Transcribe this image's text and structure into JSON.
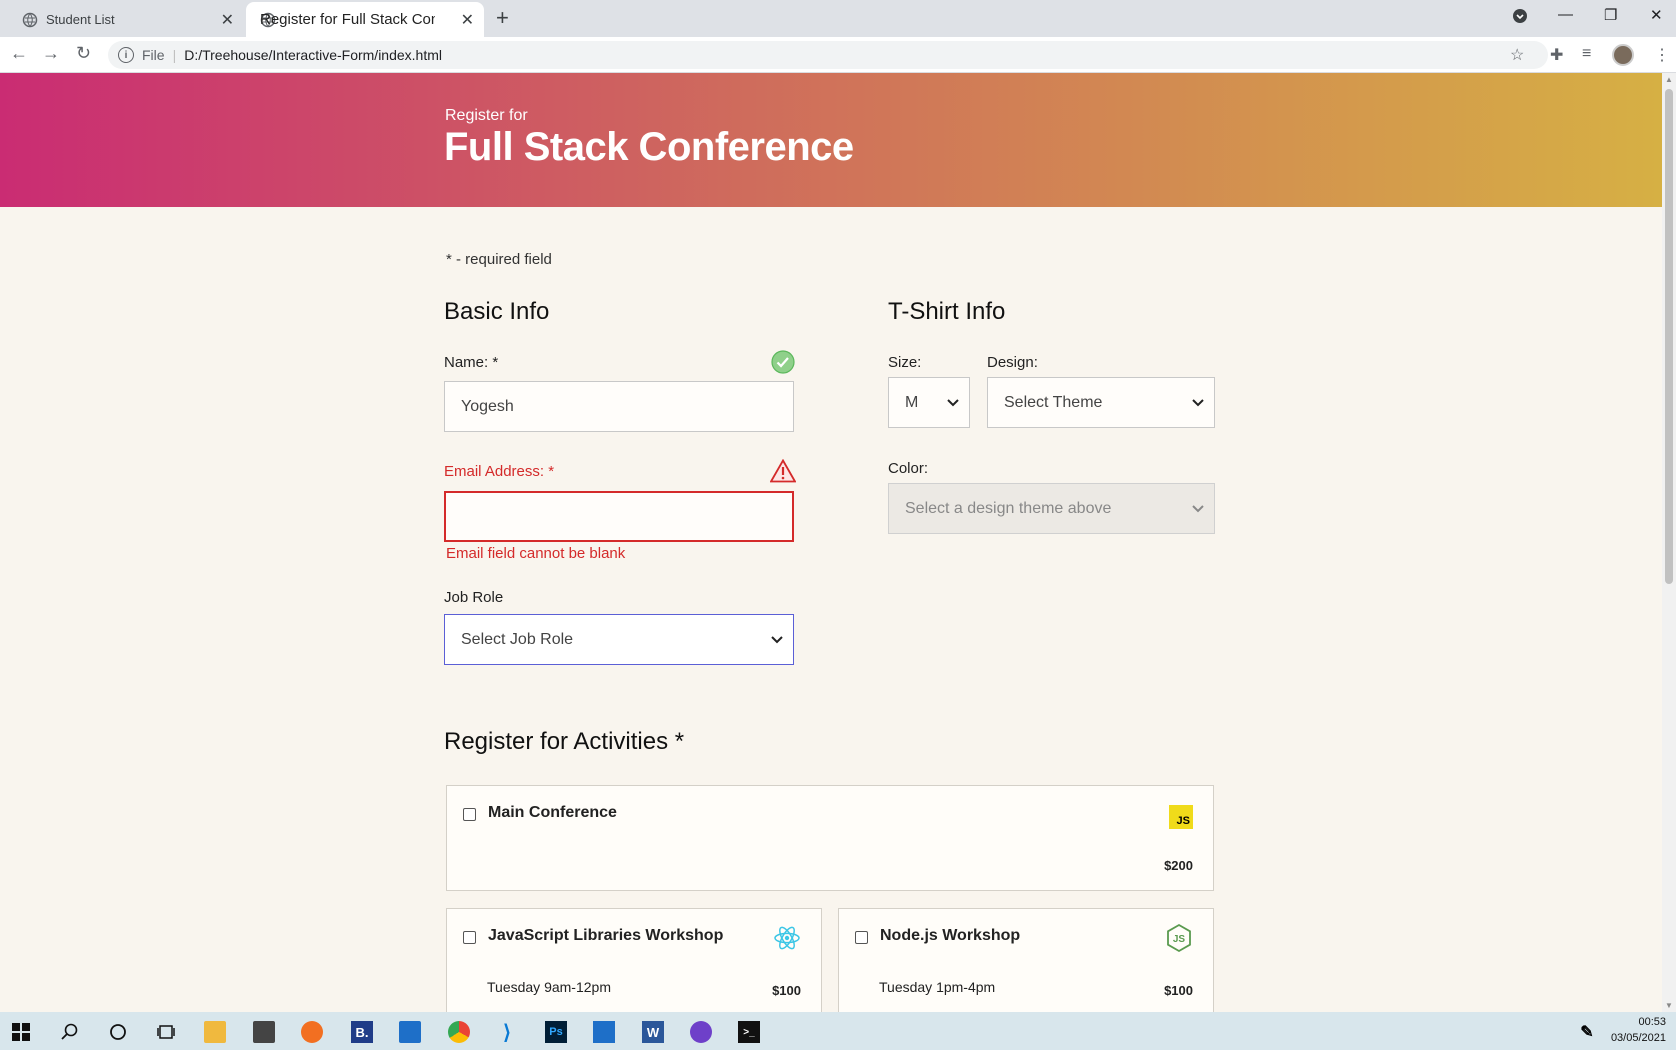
{
  "browser": {
    "tabs": [
      {
        "label": "Student List"
      },
      {
        "label": "Register for Full Stack Conference"
      }
    ],
    "url_scheme": "File",
    "url": "D:/Treehouse/Interactive-Form/index.html"
  },
  "header": {
    "pre_title": "Register for",
    "title": "Full Stack Conference"
  },
  "form": {
    "required_note": "- required field",
    "required_mark": "*",
    "basic_info": {
      "heading": "Basic Info",
      "name_label": "Name:",
      "name_value": "Yogesh",
      "email_label": "Email Address:",
      "email_value": "",
      "email_error": "Email field cannot be blank",
      "job_role_label": "Job Role",
      "job_role_selected": "Select Job Role"
    },
    "tshirt_info": {
      "heading": "T-Shirt Info",
      "size_label": "Size:",
      "size_selected": "M",
      "design_label": "Design:",
      "design_selected": "Select Theme",
      "color_label": "Color:",
      "color_selected": "Select a design theme above"
    },
    "activities": {
      "heading": "Register for Activities",
      "items": [
        {
          "name": "Main Conference",
          "time": "",
          "price": "$200",
          "icon": "js-icon",
          "checked": false
        },
        {
          "name": "JavaScript Libraries Workshop",
          "time": "Tuesday 9am-12pm",
          "price": "$100",
          "icon": "react-icon",
          "checked": false
        },
        {
          "name": "Node.js Workshop",
          "time": "Tuesday 1pm-4pm",
          "price": "$100",
          "icon": "nodejs-icon",
          "checked": false
        }
      ]
    }
  },
  "taskbar": {
    "time": "00:53",
    "date": "03/05/2021"
  },
  "colors": {
    "error": "#d42a2a",
    "focus": "#5b5fd6",
    "success": "#5cb85c",
    "gradient_start": "#ca2c73",
    "gradient_end": "#d6b044"
  }
}
